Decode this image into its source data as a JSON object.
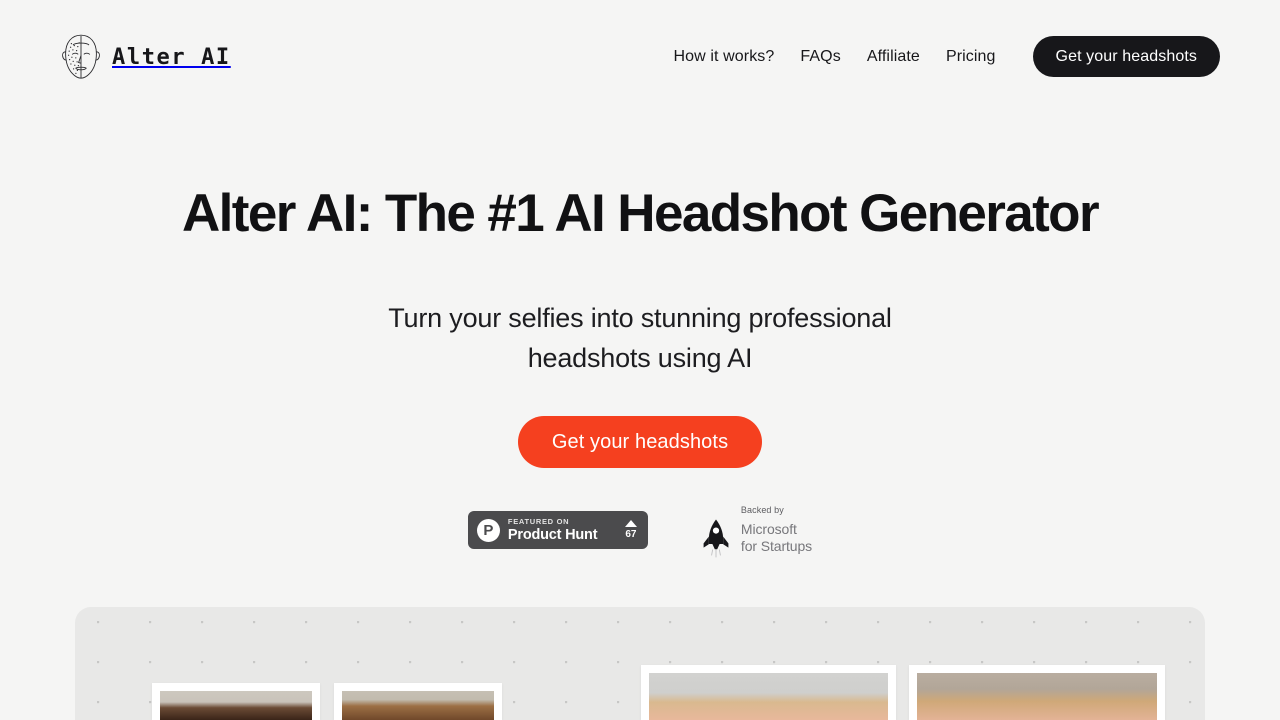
{
  "brand": {
    "name": "Alter AI",
    "logo_icon": "face-sketch-icon"
  },
  "nav": {
    "links": [
      {
        "label": "How it works?"
      },
      {
        "label": "FAQs"
      },
      {
        "label": "Affiliate"
      },
      {
        "label": "Pricing"
      }
    ],
    "cta_label": "Get your headshots"
  },
  "hero": {
    "title": "Alter AI: The #1 AI Headshot Generator",
    "subtitle_line1": "Turn your selfies into stunning professional",
    "subtitle_line2": "headshots using AI",
    "cta_label": "Get your headshots"
  },
  "badges": {
    "product_hunt": {
      "mark": "P",
      "featured_label": "FEATURED ON",
      "name": "Product Hunt",
      "upvote_icon": "upvote-triangle-icon",
      "votes": "67"
    },
    "microsoft": {
      "backed_label": "Backed by",
      "rocket_icon": "rocket-icon",
      "name_line1": "Microsoft",
      "name_line2": "for Startups"
    }
  },
  "gallery": {
    "cards": [
      {
        "alt": "headshot-brunette-woman"
      },
      {
        "alt": "headshot-curly-hair-woman"
      },
      {
        "alt": "headshot-blonde-woman-gray-background"
      },
      {
        "alt": "headshot-blonde-woman-framed-art-room"
      }
    ]
  },
  "colors": {
    "page_background": "#f5f5f4",
    "accent_orange": "#f5401f",
    "dark": "#17171a",
    "gallery_background": "#e8e8e7",
    "product_hunt_badge": "#4b4b4d"
  }
}
